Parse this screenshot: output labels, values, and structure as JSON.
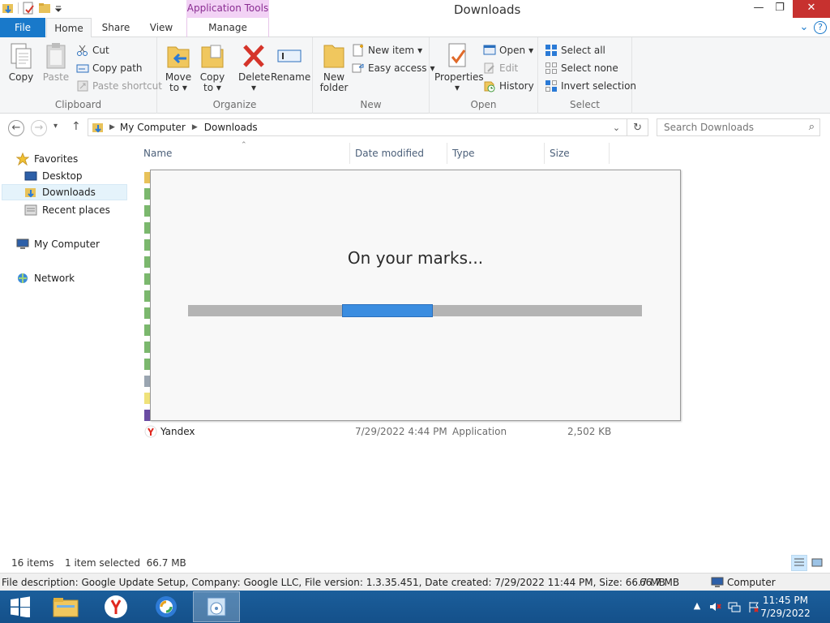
{
  "window": {
    "title": "Downloads",
    "contextual_tab_group": "Application Tools",
    "controls": {
      "minimize": "—",
      "restore": "❐",
      "close": "✕"
    }
  },
  "ribbon_tabs": {
    "file": "File",
    "home": "Home",
    "share": "Share",
    "view": "View",
    "manage": "Manage"
  },
  "ribbon": {
    "clipboard": {
      "label": "Clipboard",
      "copy": "Copy",
      "paste": "Paste",
      "cut": "Cut",
      "copy_path": "Copy path",
      "paste_shortcut": "Paste shortcut"
    },
    "organize": {
      "label": "Organize",
      "move_to": "Move",
      "move_to_2": "to",
      "copy_to": "Copy",
      "copy_to_2": "to",
      "delete": "Delete",
      "rename": "Rename"
    },
    "new": {
      "label": "New",
      "new_folder": "New",
      "new_folder_2": "folder",
      "new_item": "New item",
      "easy_access": "Easy access"
    },
    "open": {
      "label": "Open",
      "properties": "Properties",
      "open": "Open",
      "edit": "Edit",
      "history": "History"
    },
    "select": {
      "label": "Select",
      "select_all": "Select all",
      "select_none": "Select none",
      "invert_selection": "Invert selection"
    }
  },
  "address_bar": {
    "crumbs": [
      "My Computer",
      "Downloads"
    ],
    "search_placeholder": "Search Downloads"
  },
  "nav_pane": {
    "favorites": "Favorites",
    "desktop": "Desktop",
    "downloads": "Downloads",
    "recent_places": "Recent places",
    "my_computer": "My Computer",
    "network": "Network"
  },
  "file_list": {
    "columns": {
      "name": "Name",
      "date_modified": "Date modified",
      "type": "Type",
      "size": "Size"
    },
    "visible_row": {
      "name": "Yandex",
      "date_modified": "7/29/2022 4:44 PM",
      "type": "Application",
      "size": "2,502 KB"
    }
  },
  "dialog": {
    "message": "On your marks...",
    "progress_chunk_start_fraction": 0.34,
    "progress_chunk_width_fraction": 0.2,
    "accent_color": "#3b8de0"
  },
  "status_bar": {
    "item_count": "16 items",
    "selection": "1 item selected  66.7 MB"
  },
  "details_bar": {
    "description": "File description: Google Update Setup, Company: Google LLC, File version: 1.3.35.451, Date created: 7/29/2022 11:44 PM, Size: 66.7 MB",
    "size": "66.7 MB",
    "location": "Computer"
  },
  "taskbar": {
    "time": "11:45 PM",
    "date": "7/29/2022"
  }
}
